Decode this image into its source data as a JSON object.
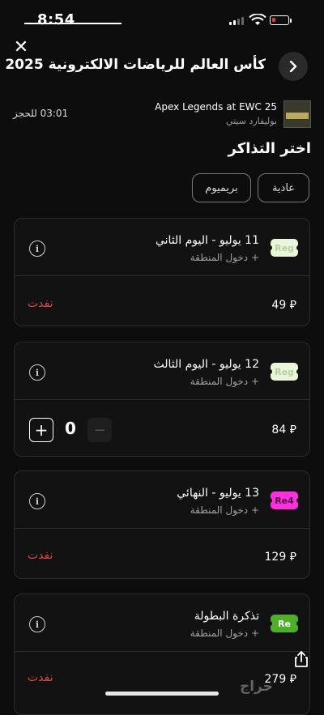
{
  "status_bar": {
    "time": "8:54",
    "overlay_left": "0",
    "battery": "00"
  },
  "header": {
    "title": "كأس العالم للرياضات الالكترونية 2025"
  },
  "event": {
    "name": "Apex Legends at EWC 25",
    "venue": "بوليفارد سيتي",
    "timer": "03:01 للحجز"
  },
  "section_title": "اختر التذاكر",
  "filters": [
    {
      "label": "عادية"
    },
    {
      "label": "بريميوم"
    }
  ],
  "tickets": [
    {
      "name": "11 يوليو - اليوم الثاني",
      "sub": "+ دخول المنطقة",
      "tag": "Reg",
      "tag_color": "#e9f7d8",
      "price": "49 ⃁",
      "status": "نفدت"
    },
    {
      "name": "12 يوليو - اليوم الثالث",
      "sub": "+ دخول المنطقة",
      "tag": "Reg",
      "tag_color": "#e9f7d8",
      "price": "84 ⃁",
      "quantity": "0"
    },
    {
      "name": "13 يوليو - النهائي",
      "sub": "+ دخول المنطقة",
      "tag": "Re4",
      "tag_color": "#ff2fe0",
      "price": "129 ⃁",
      "status": "نفدت"
    },
    {
      "name": "تذكرة البطولة",
      "sub": "+ دخول المنطقة",
      "tag": "Re",
      "tag_color": "#4caf26",
      "price": "279 ⃁",
      "status": "نفدت"
    }
  ],
  "watermark": "حراج",
  "icons": {
    "close": "close-icon",
    "back": "chevron-right-icon",
    "info": "info-icon",
    "share": "share-icon"
  }
}
